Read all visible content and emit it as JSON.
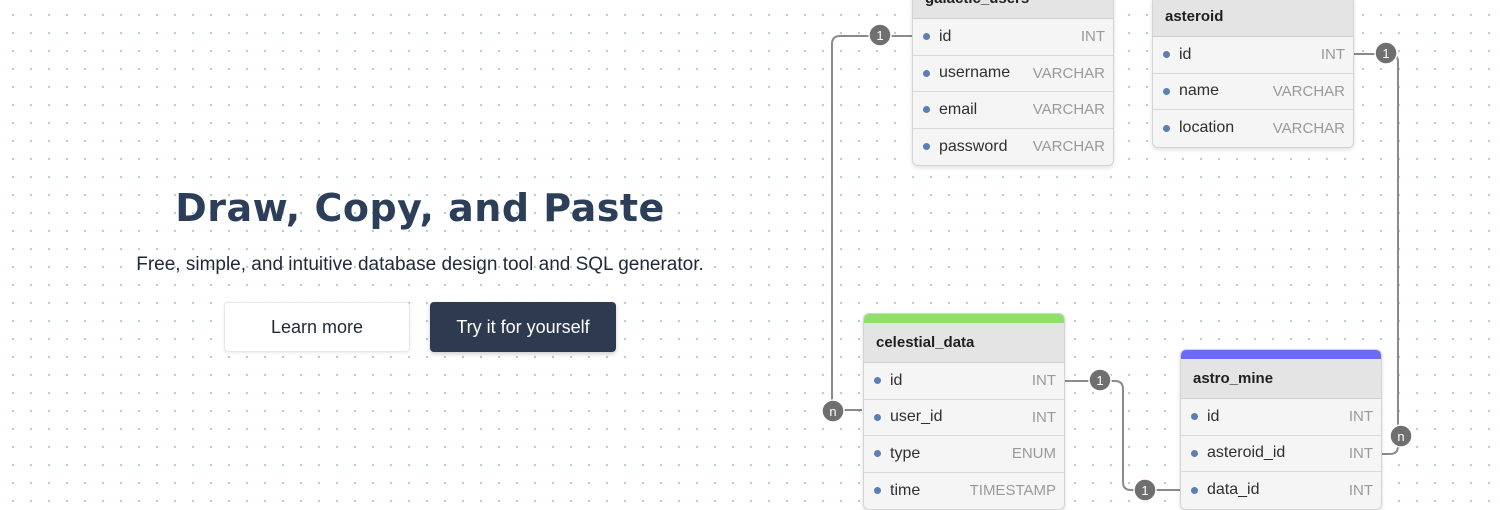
{
  "hero": {
    "title": "Draw, Copy, and Paste",
    "subtitle": "Free, simple, and intuitive database design tool and SQL generator.",
    "learn_more": "Learn more",
    "try_it": "Try it for yourself"
  },
  "colors": {
    "celestial_accent": "#8ee06a",
    "astro_mine_accent": "#6b6cf4",
    "dark_button": "#2e3a50",
    "field_dot": "#5b7fb5"
  },
  "relationships": {
    "one": "1",
    "many": "n"
  },
  "tables": {
    "galactic_users": {
      "name": "galactic_users",
      "fields": [
        {
          "name": "id",
          "type": "INT"
        },
        {
          "name": "username",
          "type": "VARCHAR"
        },
        {
          "name": "email",
          "type": "VARCHAR"
        },
        {
          "name": "password",
          "type": "VARCHAR"
        }
      ]
    },
    "asteroid": {
      "name": "asteroid",
      "fields": [
        {
          "name": "id",
          "type": "INT"
        },
        {
          "name": "name",
          "type": "VARCHAR"
        },
        {
          "name": "location",
          "type": "VARCHAR"
        }
      ]
    },
    "celestial_data": {
      "name": "celestial_data",
      "fields": [
        {
          "name": "id",
          "type": "INT"
        },
        {
          "name": "user_id",
          "type": "INT"
        },
        {
          "name": "type",
          "type": "ENUM"
        },
        {
          "name": "time",
          "type": "TIMESTAMP"
        }
      ]
    },
    "astro_mine": {
      "name": "astro_mine",
      "fields": [
        {
          "name": "id",
          "type": "INT"
        },
        {
          "name": "asteroid_id",
          "type": "INT"
        },
        {
          "name": "data_id",
          "type": "INT"
        }
      ]
    }
  }
}
